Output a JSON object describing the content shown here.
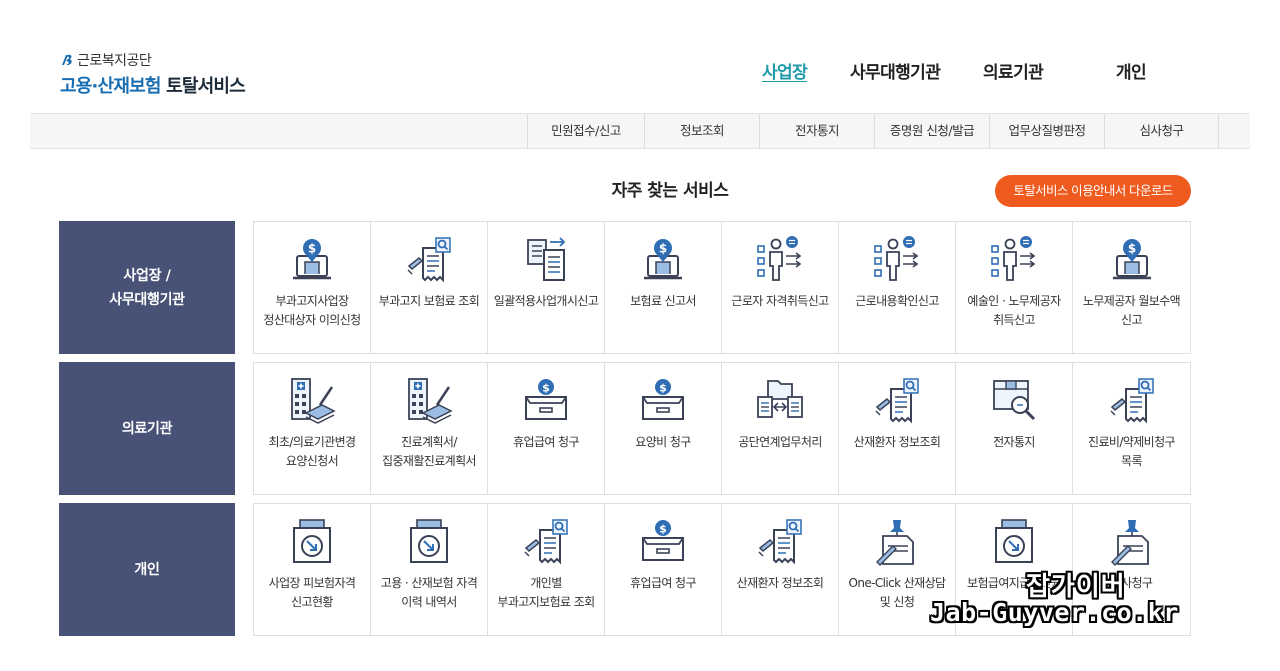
{
  "logo": {
    "org": "근로복지공단",
    "title_blue": "고용·산재보험",
    "title_dark": "토탈서비스"
  },
  "top_nav": [
    "사업장",
    "사무대행기관",
    "의료기관",
    "개인"
  ],
  "menu": [
    "민원접수/신고",
    "정보조회",
    "전자통지",
    "증명원 신청/발급",
    "업무상질병판정",
    "심사청구"
  ],
  "section_title": "자주 찾는 서비스",
  "download_button": "토탈서비스 이용안내서 다운로드",
  "rows": [
    {
      "label_line1": "사업장 /",
      "label_line2": "사무대행기관",
      "items": [
        {
          "label": "부과고지사업장 정산대상자 이의신청",
          "icon": "money-laptop-icon"
        },
        {
          "label": "부과고지 보험료 조회",
          "icon": "receipt-search-icon"
        },
        {
          "label": "일괄적용사업개시신고",
          "icon": "document-transfer-icon"
        },
        {
          "label": "보험료 신고서",
          "icon": "money-laptop-icon"
        },
        {
          "label": "근로자 자격취득신고",
          "icon": "worker-checklist-icon"
        },
        {
          "label": "근로내용확인신고",
          "icon": "worker-checklist-icon"
        },
        {
          "label": "예술인 · 노무제공자 취득신고",
          "icon": "worker-checklist-icon"
        },
        {
          "label": "노무제공자 월보수액 신고",
          "icon": "money-laptop-icon"
        }
      ]
    },
    {
      "label_line1": "의료기관",
      "label_line2": "",
      "items": [
        {
          "label": "최초/의료기관변경 요양신청서",
          "icon": "hospital-document-icon"
        },
        {
          "label": "진료계획서/집중재활진료계획서",
          "icon": "hospital-document-icon"
        },
        {
          "label": "휴업급여 청구",
          "icon": "money-box-icon"
        },
        {
          "label": "요양비 청구",
          "icon": "money-box-icon"
        },
        {
          "label": "공단연계업무처리",
          "icon": "folder-exchange-icon"
        },
        {
          "label": "산재환자 정보조회",
          "icon": "receipt-search-icon"
        },
        {
          "label": "전자통지",
          "icon": "box-search-icon"
        },
        {
          "label": "진료비/약제비청구 목록",
          "icon": "receipt-search-icon"
        }
      ]
    },
    {
      "label_line1": "개인",
      "label_line2": "",
      "items": [
        {
          "label": "사업장 피보험자격 신고현황",
          "icon": "download-tray-icon"
        },
        {
          "label": "고용 · 산재보험 자격 이력 내역서",
          "icon": "download-tray-icon"
        },
        {
          "label": "개인별 부과고지보험료 조회",
          "icon": "receipt-search-icon"
        },
        {
          "label": "휴업급여 청구",
          "icon": "money-box-icon"
        },
        {
          "label": "산재환자 정보조회",
          "icon": "receipt-search-icon"
        },
        {
          "label": "One-Click 산재상담 및 신청",
          "icon": "pin-document-icon"
        },
        {
          "label": "보험급여지급확인원",
          "icon": "download-tray-icon"
        },
        {
          "label": "심사청구",
          "icon": "pin-document-icon"
        }
      ]
    }
  ],
  "watermark": {
    "korean": "잡가이버",
    "url": "Jab-Guyver.co.kr"
  },
  "colors": {
    "accent": "#1f9aa8",
    "row_label_bg": "#485277",
    "button": "#ef5a1e",
    "icon_blue": "#2f6db5",
    "icon_dark": "#3b4257"
  }
}
